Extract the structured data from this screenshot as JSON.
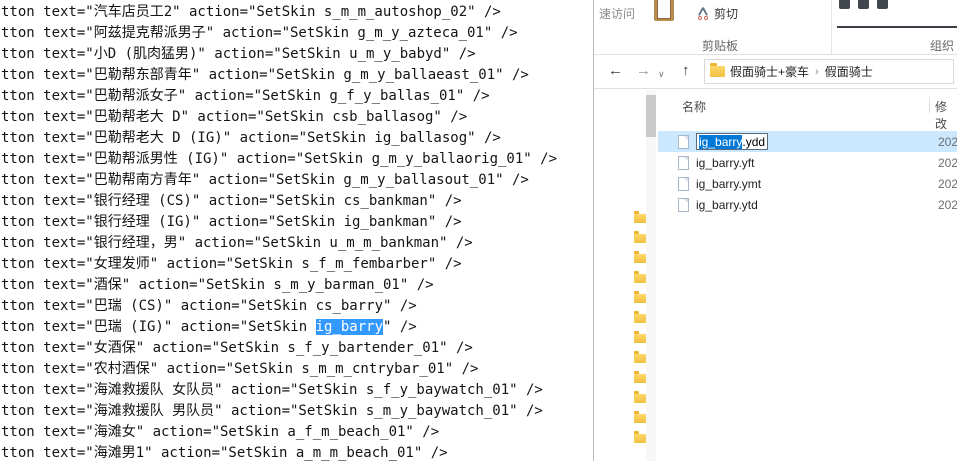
{
  "editor": {
    "lines": [
      "tton text=\"汽车店员工2\" action=\"SetSkin s_m_m_autoshop_02\" />",
      "tton text=\"阿兹提克帮派男子\" action=\"SetSkin g_m_y_azteca_01\" />",
      "tton text=\"小D (肌肉猛男)\" action=\"SetSkin u_m_y_babyd\" />",
      "tton text=\"巴勒帮东部青年\" action=\"SetSkin g_m_y_ballaeast_01\" />",
      "tton text=\"巴勒帮派女子\" action=\"SetSkin g_f_y_ballas_01\" />",
      "tton text=\"巴勒帮老大 D\" action=\"SetSkin csb_ballasog\" />",
      "tton text=\"巴勒帮老大 D (IG)\" action=\"SetSkin ig_ballasog\" />",
      "tton text=\"巴勒帮派男性 (IG)\" action=\"SetSkin g_m_y_ballaorig_01\" />",
      "tton text=\"巴勒帮南方青年\" action=\"SetSkin g_m_y_ballasout_01\" />",
      "tton text=\"银行经理 (CS)\" action=\"SetSkin cs_bankman\" />",
      "tton text=\"银行经理 (IG)\" action=\"SetSkin ig_bankman\" />",
      "tton text=\"银行经理，男\" action=\"SetSkin u_m_m_bankman\" />",
      "tton text=\"女理发师\" action=\"SetSkin s_f_m_fembarber\" />",
      "tton text=\"酒保\" action=\"SetSkin s_m_y_barman_01\" />",
      "tton text=\"巴瑞 (CS)\" action=\"SetSkin cs_barry\" />",
      "tton text=\"巴瑞 (IG)\" action=\"SetSkin ig_barry\" />",
      "tton text=\"女酒保\" action=\"SetSkin s_f_y_bartender_01\" />",
      "tton text=\"农村酒保\" action=\"SetSkin s_m_m_cntrybar_01\" />",
      "tton text=\"海滩救援队 女队员\" action=\"SetSkin s_f_y_baywatch_01\" />",
      "tton text=\"海滩救援队 男队员\" action=\"SetSkin s_m_y_baywatch_01\" />",
      "tton text=\"海滩女\" action=\"SetSkin a_f_m_beach_01\" />",
      "tton text=\"海滩男1\" action=\"SetSkin a_m_m_beach_01\" />"
    ],
    "selection": {
      "line": 15,
      "text": "ig_barry"
    },
    "selection_color": "#3399ff"
  },
  "explorer": {
    "ribbon": {
      "pin_label": "速访问",
      "cut_label": "剪切",
      "clipboard_group_label": "剪贴板",
      "organize_group_label": "组织"
    },
    "navbar": {
      "back_icon": "←",
      "forward_icon": "→",
      "recent_dropdown_icon": "∨",
      "up_icon": "↑",
      "breadcrumb": [
        "假面骑士+豪车",
        "假面骑士"
      ],
      "breadcrumb_separator": "›"
    },
    "nav_pane": {
      "folder_count": 12
    },
    "file_list": {
      "columns": {
        "name": "名称",
        "modified": "修改"
      },
      "selected_row_color": "#cce8ff",
      "rename_selection_color": "#0078d7",
      "rows": [
        {
          "base": "ig_barry",
          "ext": ".ydd",
          "date": "202",
          "selected": true,
          "renaming": true
        },
        {
          "name": "ig_barry.yft",
          "date": "202"
        },
        {
          "name": "ig_barry.ymt",
          "date": "202"
        },
        {
          "name": "ig_barry.ytd",
          "date": "202"
        }
      ]
    }
  }
}
